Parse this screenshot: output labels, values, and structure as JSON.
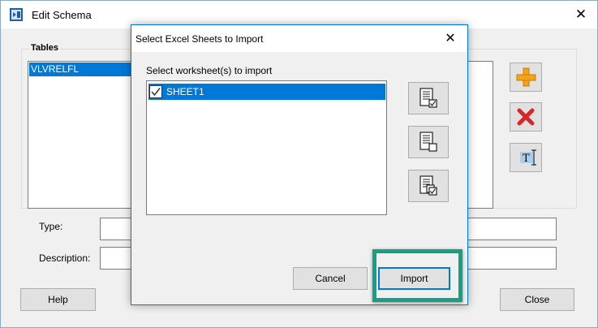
{
  "outer_window": {
    "title": "Edit Schema",
    "close_glyph": "✕",
    "tables_group_label": "Tables",
    "tables_items": [
      "VLVRELFL"
    ],
    "type_label": "Type:",
    "type_value": "",
    "description_label": "Description:",
    "description_value": "",
    "help_label": "Help",
    "close_label": "Close",
    "side_buttons": [
      "plus-icon",
      "delete-icon",
      "rename-icon"
    ]
  },
  "dialog": {
    "title": "Select Excel Sheets to Import",
    "close_glyph": "✕",
    "worksheet_label": "Select worksheet(s) to import",
    "worksheets": [
      {
        "name": "SHEET1",
        "checked": true,
        "selected": true
      }
    ],
    "icon_buttons": [
      "select-all-icon",
      "deselect-all-icon",
      "invert-selection-icon"
    ],
    "cancel_label": "Cancel",
    "import_label": "Import"
  },
  "colors": {
    "selection": "#0078d7",
    "highlight": "#14a085",
    "add_icon": "#f7a21b",
    "delete_icon": "#d9262b"
  }
}
